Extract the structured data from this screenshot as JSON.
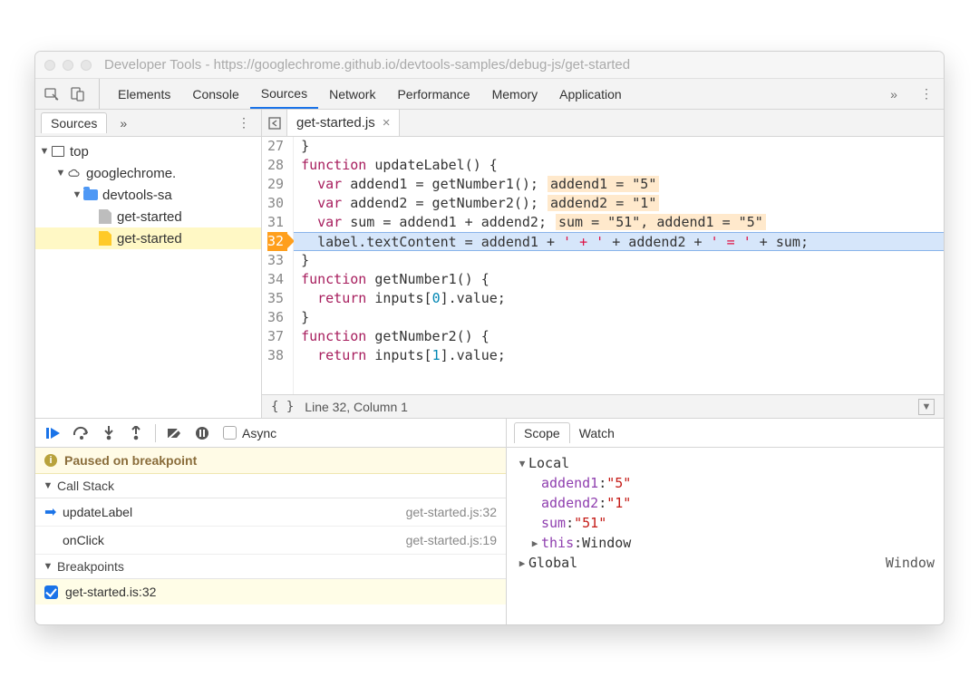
{
  "window_title": "Developer Tools - https://googlechrome.github.io/devtools-samples/debug-js/get-started",
  "toolbar_tabs": [
    "Elements",
    "Console",
    "Sources",
    "Network",
    "Performance",
    "Memory",
    "Application"
  ],
  "toolbar_active_tab": "Sources",
  "more_tabs_glyph": "»",
  "sources_panel": {
    "tab_label": "Sources",
    "tree": {
      "top": "top",
      "origin": "googlechrome.",
      "folder": "devtools-sa",
      "file_html": "get-started",
      "file_js": "get-started"
    }
  },
  "editor": {
    "open_file": "get-started.js",
    "gutter_start": 27,
    "breakpoint_line": 32,
    "lines": {
      "l27": "}",
      "l28a": "function",
      "l28b": " updateLabel() {",
      "l29a": "  var",
      "l29b": " addend1 = getNumber1();",
      "l29c": "addend1 = \"5\"",
      "l30a": "  var",
      "l30b": " addend2 = getNumber2();",
      "l30c": "addend2 = \"1\"",
      "l31a": "  var",
      "l31b": " sum = addend1 + addend2;",
      "l31c": "sum = \"51\", addend1 = \"5\"",
      "l32a": "  label.textContent = addend1 + ",
      "l32b": "' + '",
      "l32c": " + addend2 + ",
      "l32d": "' = '",
      "l32e": " + sum;",
      "l33": "}",
      "l34a": "function",
      "l34b": " getNumber1() {",
      "l35a": "  return",
      "l35b": " inputs[",
      "l35c": "0",
      "l35d": "].value;",
      "l36": "}",
      "l37a": "function",
      "l37b": " getNumber2() {",
      "l38a": "  return",
      "l38b": " inputs[",
      "l38c": "1",
      "l38d": "].value;"
    },
    "status": "Line 32, Column 1",
    "format_icon": "{ }"
  },
  "debugger": {
    "async_label": "Async",
    "paused_msg": "Paused on breakpoint",
    "call_stack_label": "Call Stack",
    "call_stack": [
      {
        "fn": "updateLabel",
        "loc": "get-started.js:32",
        "current": true
      },
      {
        "fn": "onClick",
        "loc": "get-started.js:19",
        "current": false
      }
    ],
    "breakpoints_label": "Breakpoints",
    "breakpoints": [
      {
        "label": "get-started.is:32",
        "enabled": true
      }
    ]
  },
  "scope": {
    "tabs": [
      "Scope",
      "Watch"
    ],
    "local_label": "Local",
    "vars": [
      {
        "name": "addend1",
        "value": "\"5\""
      },
      {
        "name": "addend2",
        "value": "\"1\""
      },
      {
        "name": "sum",
        "value": "\"51\""
      }
    ],
    "this_label": "this",
    "this_value": "Window",
    "global_label": "Global",
    "global_value": "Window"
  },
  "gutter_nums": {
    "n27": "27",
    "n28": "28",
    "n29": "29",
    "n30": "30",
    "n31": "31",
    "n32": "32",
    "n33": "33",
    "n34": "34",
    "n35": "35",
    "n36": "36",
    "n37": "37",
    "n38": "38"
  }
}
